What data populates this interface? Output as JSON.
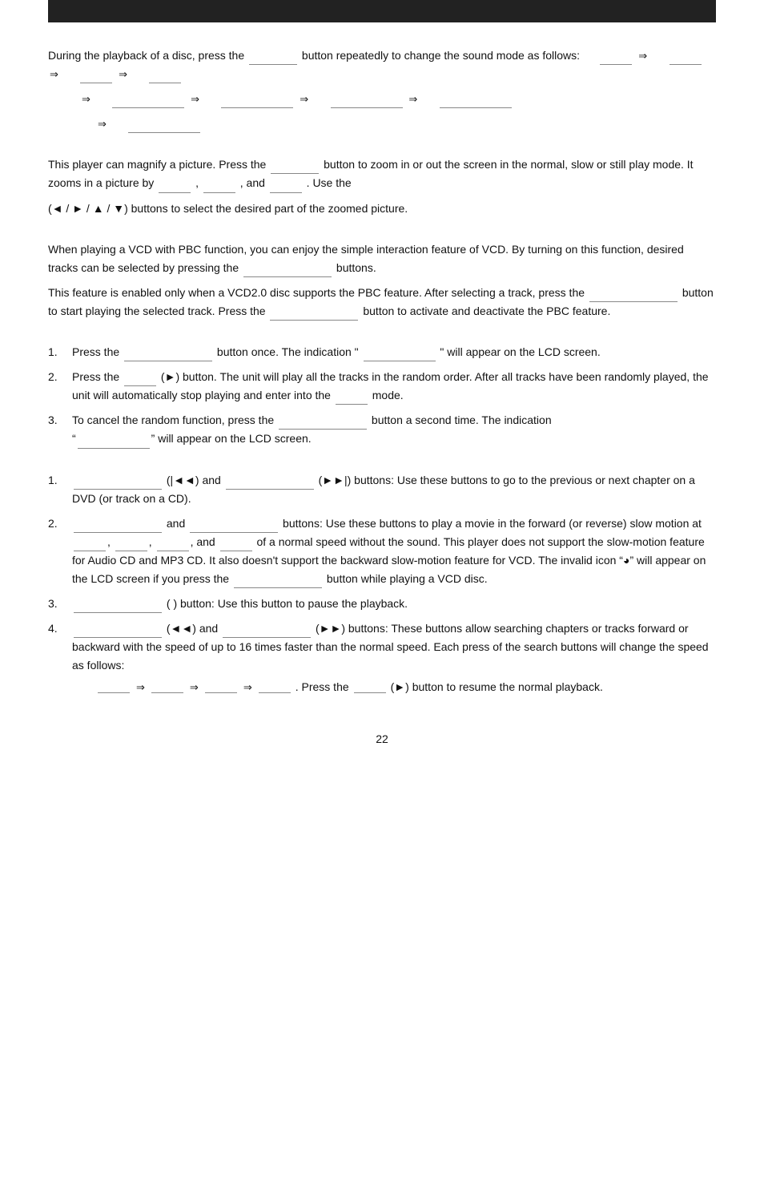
{
  "header": {
    "bar_color": "#222"
  },
  "page_number": "22",
  "sections": {
    "sound_mode": {
      "text1": "During the playback of a disc, press the",
      "text2": "button repeatedly to change the sound mode as follows:",
      "arrows": [
        "⇒",
        "⇒",
        "⇒"
      ],
      "row2_arrows": [
        "⇒",
        "⇒",
        "⇒",
        "⇒"
      ],
      "row3_arrow": "⇒"
    },
    "zoom": {
      "text1": "This player can magnify a picture. Press the",
      "text2": "button to zoom in or out the screen in the normal, slow or still play mode. It zooms in a picture by",
      "text3": ", and",
      "text4": ". Use the",
      "text5": "(◄ / ► / ▲ / ▼) buttons to select the desired part of the zoomed picture."
    },
    "pbc": {
      "p1": "When playing a VCD with PBC function, you can enjoy the simple interaction feature of VCD. By turning on this function, desired tracks can be selected by pressing the",
      "p1_end": "buttons.",
      "p2": "This feature is enabled only when a VCD2.0 disc supports the PBC feature. After selecting a track, press the",
      "p2_mid": "button to start playing the selected track. Press the",
      "p2_end": "button to activate and deactivate the PBC feature."
    },
    "random": {
      "items": [
        {
          "num": "1.",
          "text_start": "Press the",
          "text_mid": "button once. The indication \"",
          "text_mid2": "\" will appear on the LCD screen."
        },
        {
          "num": "2.",
          "text_start": "Press the",
          "text_mid": "(►) button. The unit will play all the tracks in the random order. After all tracks have been randomly played, the unit will automatically stop playing and enter into the",
          "text_end": "mode."
        },
        {
          "num": "3.",
          "text_start": "To cancel the random function, press the",
          "text_mid": "button a second time. The indication",
          "text_end": "\" will appear on the LCD screen."
        }
      ]
    },
    "playback": {
      "items": [
        {
          "num": "1.",
          "text_start": "(|◄◄) and",
          "text_mid": "(►►|) buttons: Use these buttons to go to the previous or next chapter on a DVD (or track on a CD)."
        },
        {
          "num": "2.",
          "text_start": "and",
          "text_mid": "buttons: Use these buttons to play a movie in the forward (or reverse) slow motion at",
          "text_mid2": ",",
          "text_mid3": ", and",
          "text_mid4": "of a normal speed without the sound. This player does not support the slow-motion feature for Audio CD and MP3 CD. It also doesn't support the backward slow-motion feature for VCD. The invalid icon",
          "text_mid5": "\" will appear on the LCD screen if you press the",
          "text_mid6": "button while playing a VCD disc."
        },
        {
          "num": "3.",
          "text_start": "( ) button: Use this button to pause the playback."
        },
        {
          "num": "4.",
          "text_start": "(◄◄) and",
          "text_mid": "(►►) buttons: These buttons allow searching chapters or tracks forward or backward with the speed of up to 16 times faster than the normal speed. Each press of the search buttons will change the speed as follows:",
          "arrows": [
            "⇒",
            "⇒",
            "⇒"
          ],
          "text_end": ". Press the",
          "text_end2": "(►) button to resume the normal playback."
        }
      ]
    }
  }
}
